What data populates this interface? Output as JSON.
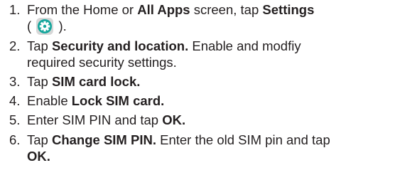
{
  "steps": [
    {
      "number": "1.",
      "line1": {
        "t1": "From the Home or ",
        "b1": "All Apps",
        "t2": " screen, tap ",
        "b2": "Settings"
      },
      "line2": {
        "open": "(",
        "icon": "settings-gear-icon",
        "close": ")."
      }
    },
    {
      "number": "2.",
      "line1": {
        "t1": "Tap ",
        "b1": "Security and location.",
        "t2": " Enable and modfiy"
      },
      "line2": {
        "t1": "required security settings."
      }
    },
    {
      "number": "3.",
      "line1": {
        "t1": "Tap ",
        "b1": "SIM card lock."
      }
    },
    {
      "number": "4.",
      "line1": {
        "t1": "Enable ",
        "b1": "Lock SIM card."
      }
    },
    {
      "number": "5.",
      "line1": {
        "t1": "Enter SIM PIN and tap ",
        "b1": "OK."
      }
    },
    {
      "number": "6.",
      "line1": {
        "t1": "Tap ",
        "b1": "Change SIM PIN.",
        "t2": " Enter the old SIM pin and tap"
      },
      "line2": {
        "b1": "OK."
      }
    }
  ],
  "colors": {
    "text": "#231f20",
    "icon_bg": "#d7d7d7",
    "icon_circle": "#15a69c"
  }
}
